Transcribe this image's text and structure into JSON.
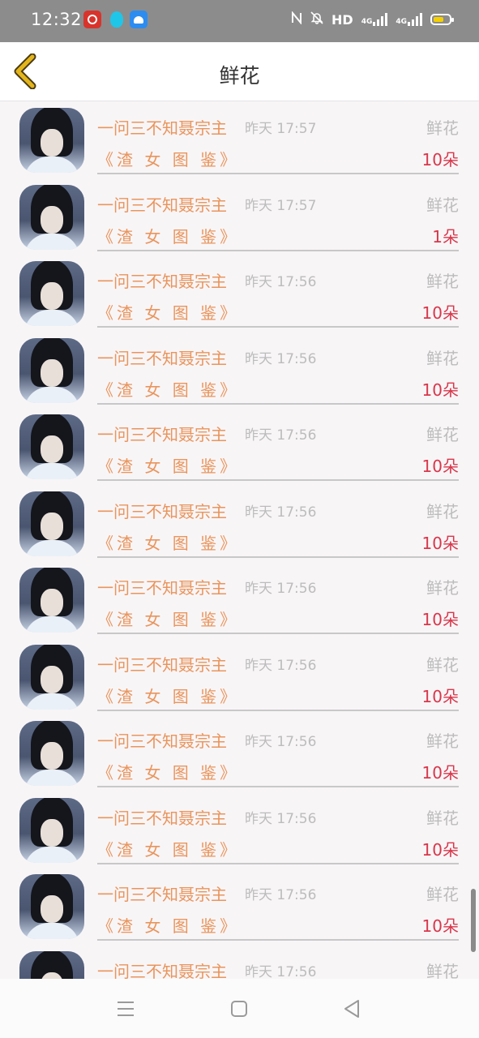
{
  "status_bar": {
    "time": "12:32",
    "hd_label": "HD",
    "network_labels": [
      "4G",
      "4G"
    ],
    "battery_color": "#f5d000",
    "icons": [
      "red-app-icon",
      "cyan-app-icon",
      "blue-app-icon",
      "nfc-icon",
      "mute-bell-icon",
      "signal-icon",
      "battery-icon"
    ]
  },
  "header": {
    "title": "鲜花",
    "back_icon": "chevron-left-icon",
    "back_icon_color": "#d4a814"
  },
  "colors": {
    "name": "#e9955c",
    "timestamp": "#bcbcbc",
    "count": "#d8374a"
  },
  "items": [
    {
      "name": "一问三不知聂宗主",
      "time": "昨天 17:57",
      "gift": "鲜花",
      "book": "《渣 女 图 鉴》",
      "count": "10朵"
    },
    {
      "name": "一问三不知聂宗主",
      "time": "昨天 17:57",
      "gift": "鲜花",
      "book": "《渣 女 图 鉴》",
      "count": "1朵"
    },
    {
      "name": "一问三不知聂宗主",
      "time": "昨天 17:56",
      "gift": "鲜花",
      "book": "《渣 女 图 鉴》",
      "count": "10朵"
    },
    {
      "name": "一问三不知聂宗主",
      "time": "昨天 17:56",
      "gift": "鲜花",
      "book": "《渣 女 图 鉴》",
      "count": "10朵"
    },
    {
      "name": "一问三不知聂宗主",
      "time": "昨天 17:56",
      "gift": "鲜花",
      "book": "《渣 女 图 鉴》",
      "count": "10朵"
    },
    {
      "name": "一问三不知聂宗主",
      "time": "昨天 17:56",
      "gift": "鲜花",
      "book": "《渣 女 图 鉴》",
      "count": "10朵"
    },
    {
      "name": "一问三不知聂宗主",
      "time": "昨天 17:56",
      "gift": "鲜花",
      "book": "《渣 女 图 鉴》",
      "count": "10朵"
    },
    {
      "name": "一问三不知聂宗主",
      "time": "昨天 17:56",
      "gift": "鲜花",
      "book": "《渣 女 图 鉴》",
      "count": "10朵"
    },
    {
      "name": "一问三不知聂宗主",
      "time": "昨天 17:56",
      "gift": "鲜花",
      "book": "《渣 女 图 鉴》",
      "count": "10朵"
    },
    {
      "name": "一问三不知聂宗主",
      "time": "昨天 17:56",
      "gift": "鲜花",
      "book": "《渣 女 图 鉴》",
      "count": "10朵"
    },
    {
      "name": "一问三不知聂宗主",
      "time": "昨天 17:56",
      "gift": "鲜花",
      "book": "《渣 女 图 鉴》",
      "count": "10朵"
    },
    {
      "name": "一问三不知聂宗主",
      "time": "昨天 17:56",
      "gift": "鲜花"
    }
  ],
  "nav_bar": {
    "buttons": [
      "menu-icon",
      "home-square-icon",
      "back-triangle-icon"
    ]
  }
}
